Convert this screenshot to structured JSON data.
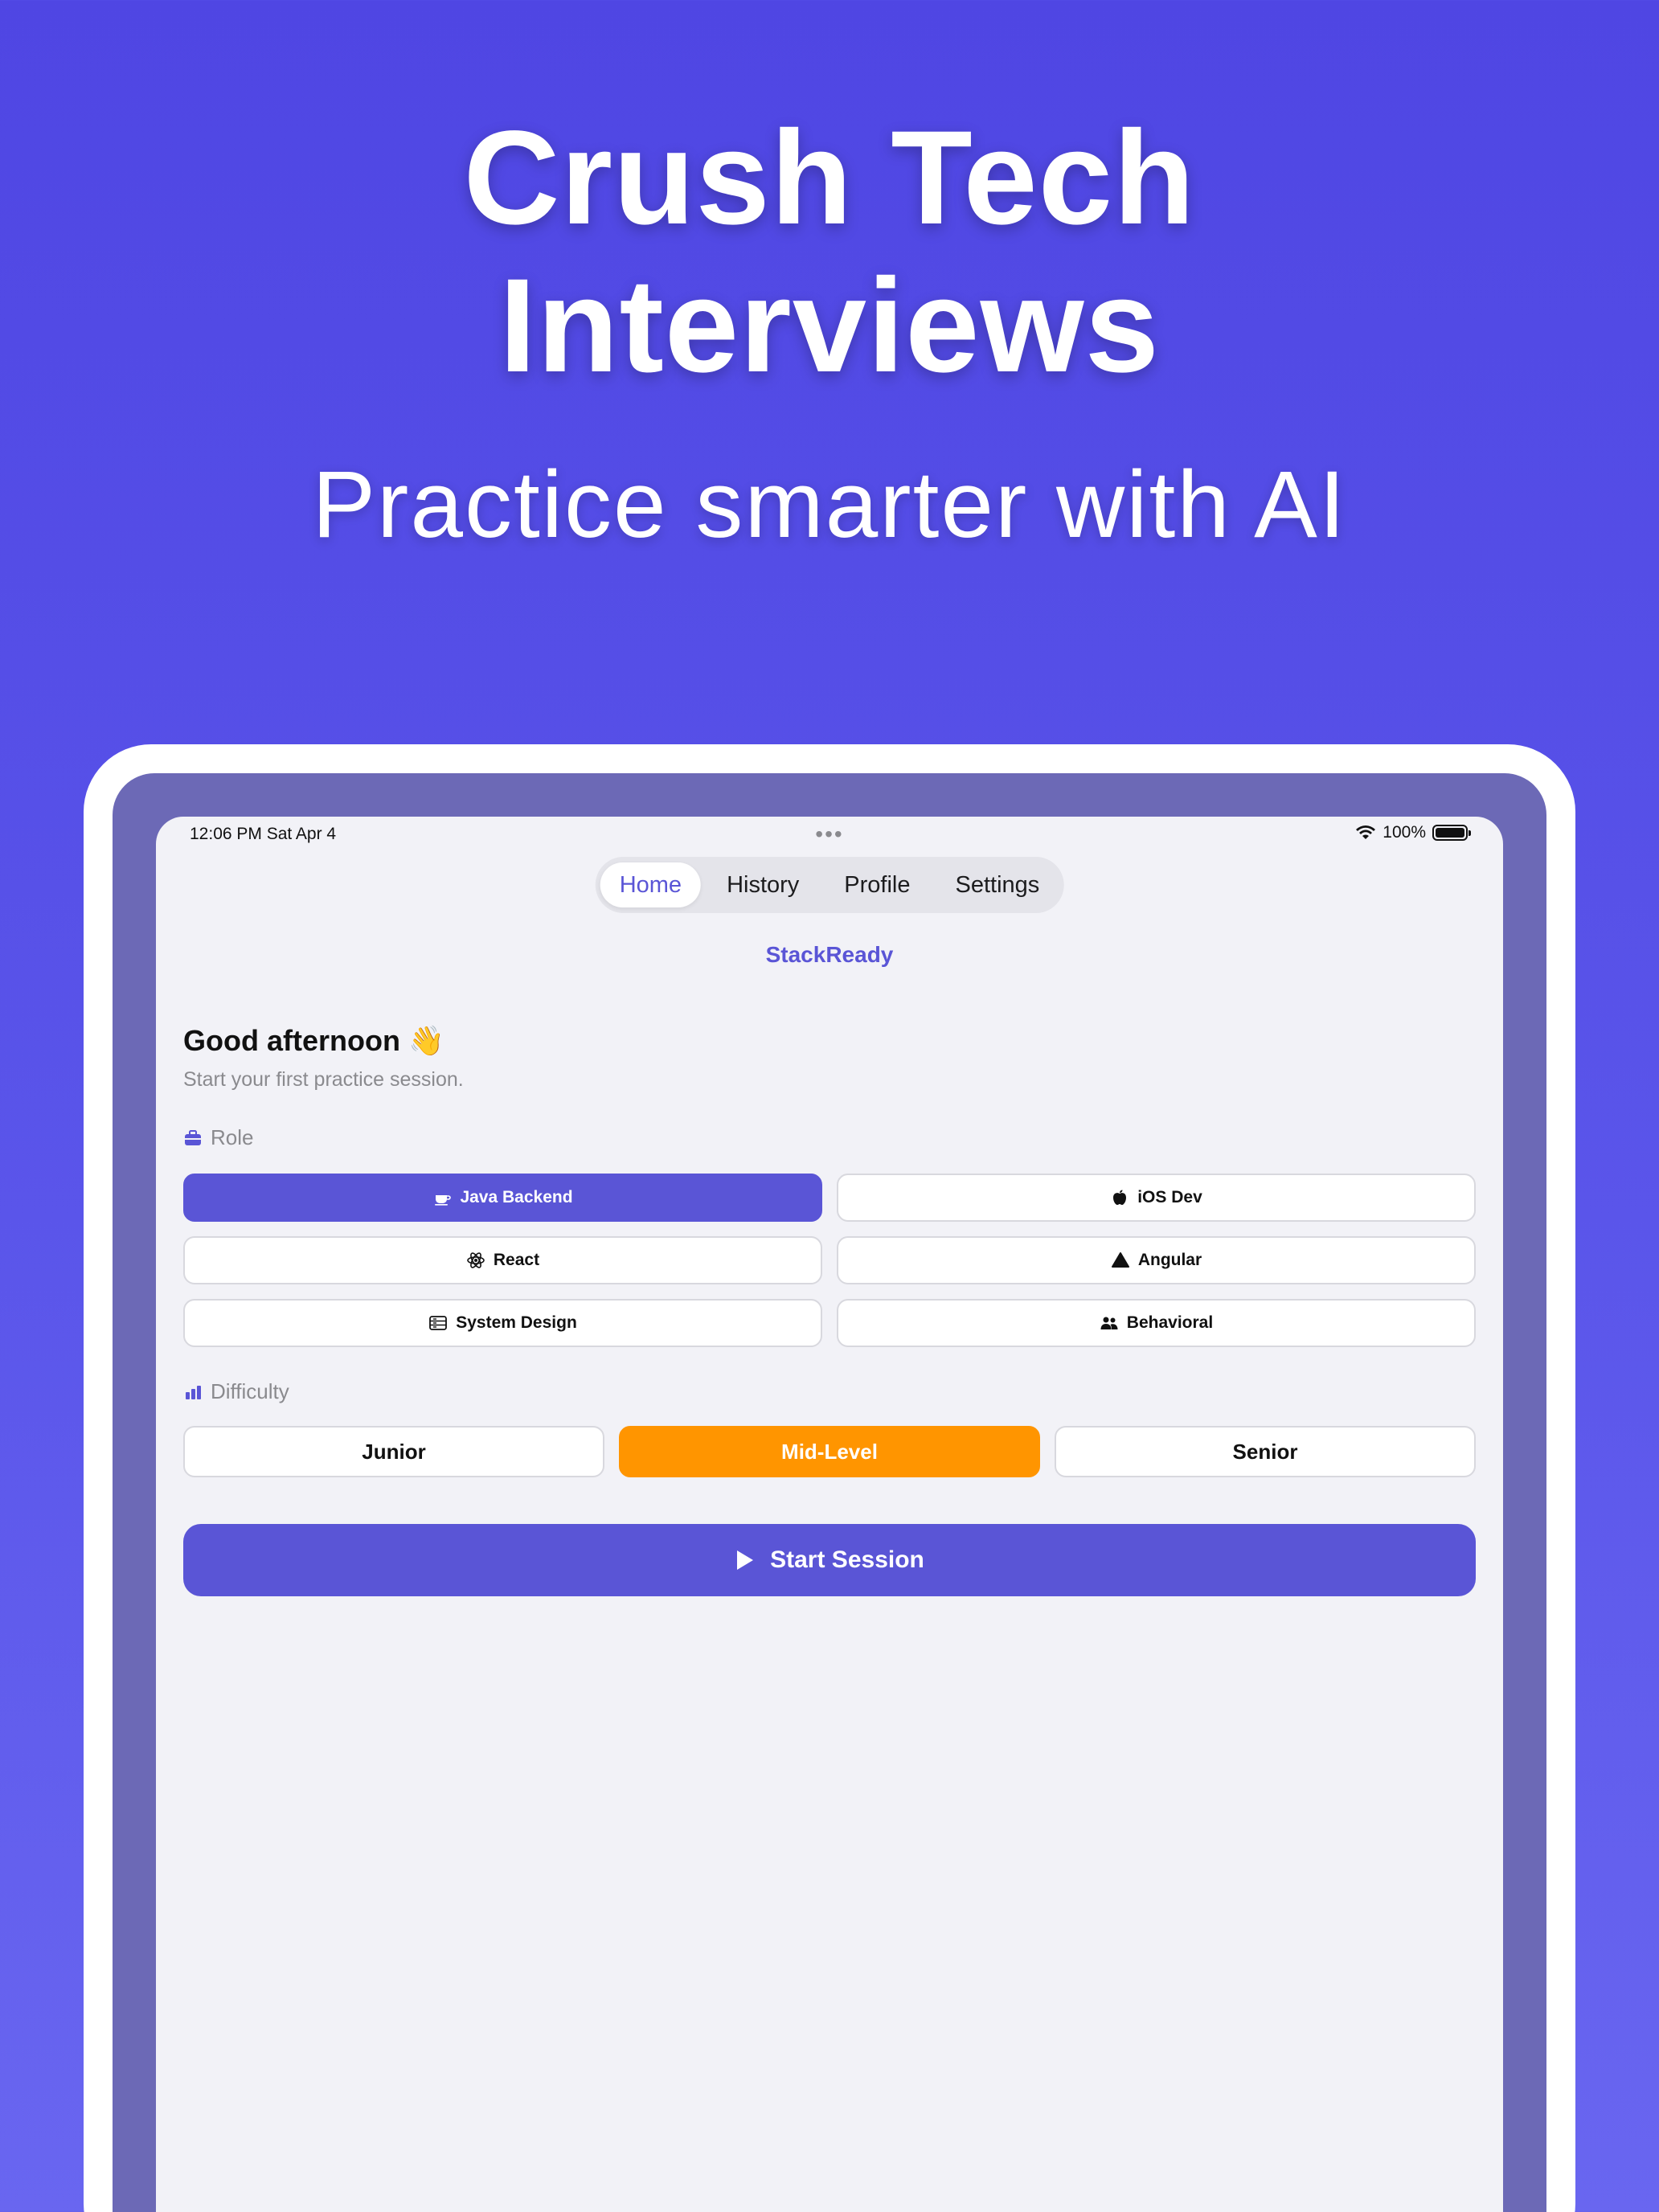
{
  "hero": {
    "title_line1": "Crush Tech",
    "title_line2": "Interviews",
    "subtitle": "Practice smarter with AI"
  },
  "status_bar": {
    "time": "12:06 PM   Sat Apr 4",
    "battery": "100%"
  },
  "tabs": [
    {
      "label": "Home",
      "active": true
    },
    {
      "label": "History",
      "active": false
    },
    {
      "label": "Profile",
      "active": false
    },
    {
      "label": "Settings",
      "active": false
    }
  ],
  "app_name": "StackReady",
  "greeting": {
    "title": "Good afternoon 👋",
    "subtitle": "Start your first practice session."
  },
  "role": {
    "label": "Role",
    "icon": "briefcase-icon",
    "options": [
      {
        "label": "Java Backend",
        "icon": "cup-icon",
        "selected": true
      },
      {
        "label": "iOS Dev",
        "icon": "apple-icon",
        "selected": false
      },
      {
        "label": "React",
        "icon": "atom-icon",
        "selected": false
      },
      {
        "label": "Angular",
        "icon": "triangle-icon",
        "selected": false
      },
      {
        "label": "System Design",
        "icon": "server-icon",
        "selected": false
      },
      {
        "label": "Behavioral",
        "icon": "people-icon",
        "selected": false
      }
    ]
  },
  "difficulty": {
    "label": "Difficulty",
    "icon": "bar-chart-icon",
    "options": [
      {
        "label": "Junior",
        "selected": false
      },
      {
        "label": "Mid-Level",
        "selected": true
      },
      {
        "label": "Senior",
        "selected": false
      }
    ]
  },
  "start_button": {
    "label": "Start Session",
    "icon": "play-icon"
  },
  "colors": {
    "background": "#4F46E3",
    "accent": "#5A55D6",
    "selected_difficulty": "#FF9500",
    "screen_bg": "#F2F2F7"
  }
}
